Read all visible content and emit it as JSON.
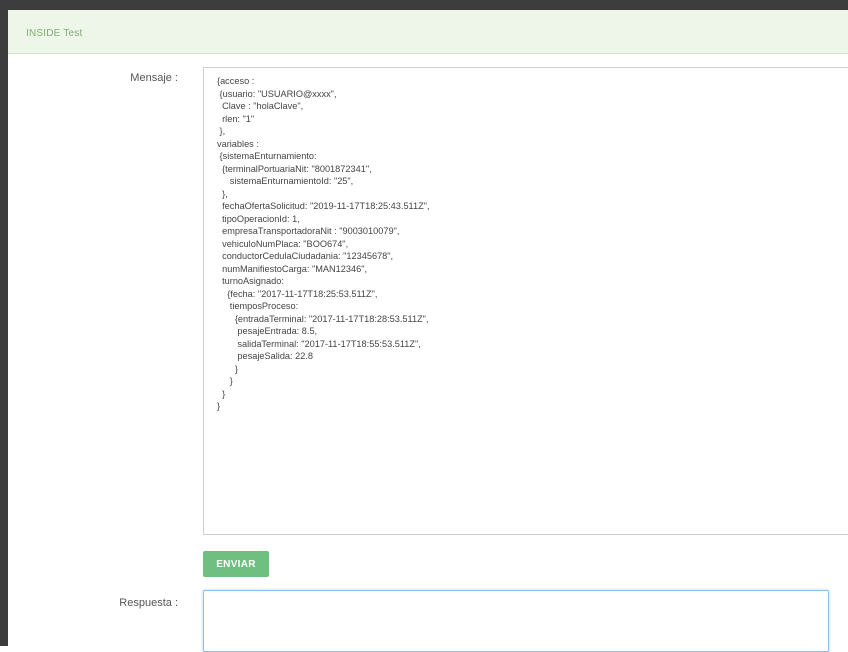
{
  "header": {
    "title": "INSIDE Test"
  },
  "form": {
    "mensaje_label": "Mensaje :",
    "mensaje_value": "{acceso :\n {usuario: \"USUARIO@xxxx\",\n  Clave : \"holaClave\",\n  rlen: \"1\"\n },\nvariables :\n {sistemaEnturnamiento:\n  {terminalPortuariaNit: \"8001872341\",\n     sistemaEnturnamientoId: \"25\",\n  },\n  fechaOfertaSolicitud: \"2019-11-17T18:25:43.511Z\",\n  tipoOperacionId: 1,\n  empresaTransportadoraNit : \"9003010079\",\n  vehiculoNumPlaca: \"BOO674\",\n  conductorCedulaCiudadania: \"12345678\",\n  numManifiestoCarga: \"MAN12346\",\n  turnoAsignado:\n    {fecha: \"2017-11-17T18:25:53.511Z\",\n     tiemposProceso:\n       {entradaTerminal: \"2017-11-17T18:28:53.511Z\",\n        pesajeEntrada: 8.5,\n        salidaTerminal: \"2017-11-17T18:55:53.511Z\",\n        pesajeSalida: 22.8\n       }\n     }\n  }\n}",
    "send_label": "ENVIAR",
    "respuesta_label": "Respuesta :",
    "respuesta_value": ""
  },
  "colors": {
    "header_bg": "#eef6ea",
    "header_text": "#7fae73",
    "send_button_bg": "#6fbf80",
    "response_focus_border": "#8fc0e8"
  }
}
